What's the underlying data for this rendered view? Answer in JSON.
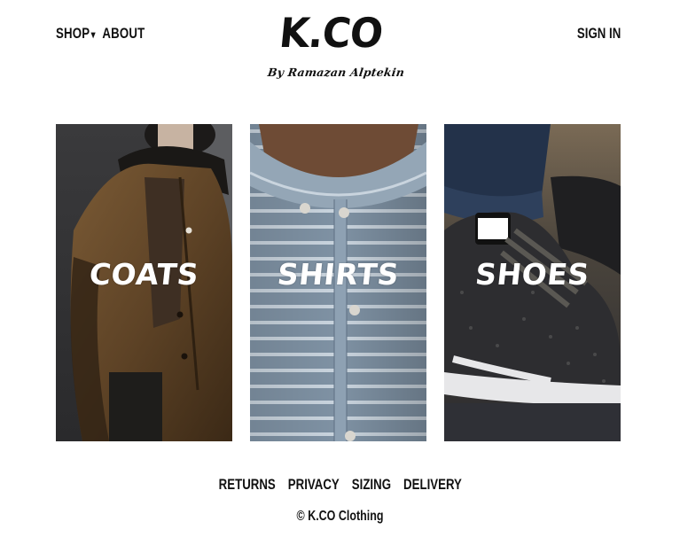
{
  "header": {
    "nav_left": [
      {
        "label": "SHOP",
        "has_dropdown": true
      },
      {
        "label": "ABOUT"
      }
    ],
    "dropdown_caret": "▾",
    "sign_in": "SIGN IN"
  },
  "logo": {
    "main": "K.CO",
    "tagline": "By Ramazan Alptekin"
  },
  "categories": [
    {
      "label": "COATS",
      "image": "model-in-brown-coat"
    },
    {
      "label": "SHIRTS",
      "image": "striped-shirt-closeup"
    },
    {
      "label": "SHOES",
      "image": "nike-air-max-sneakers"
    }
  ],
  "footer": {
    "links": [
      "RETURNS",
      "PRIVACY",
      "SIZING",
      "DELIVERY"
    ],
    "copyright": "© K.CO Clothing"
  },
  "colors": {
    "text": "#111111",
    "background": "#ffffff",
    "overlay_text": "#ffffff"
  }
}
